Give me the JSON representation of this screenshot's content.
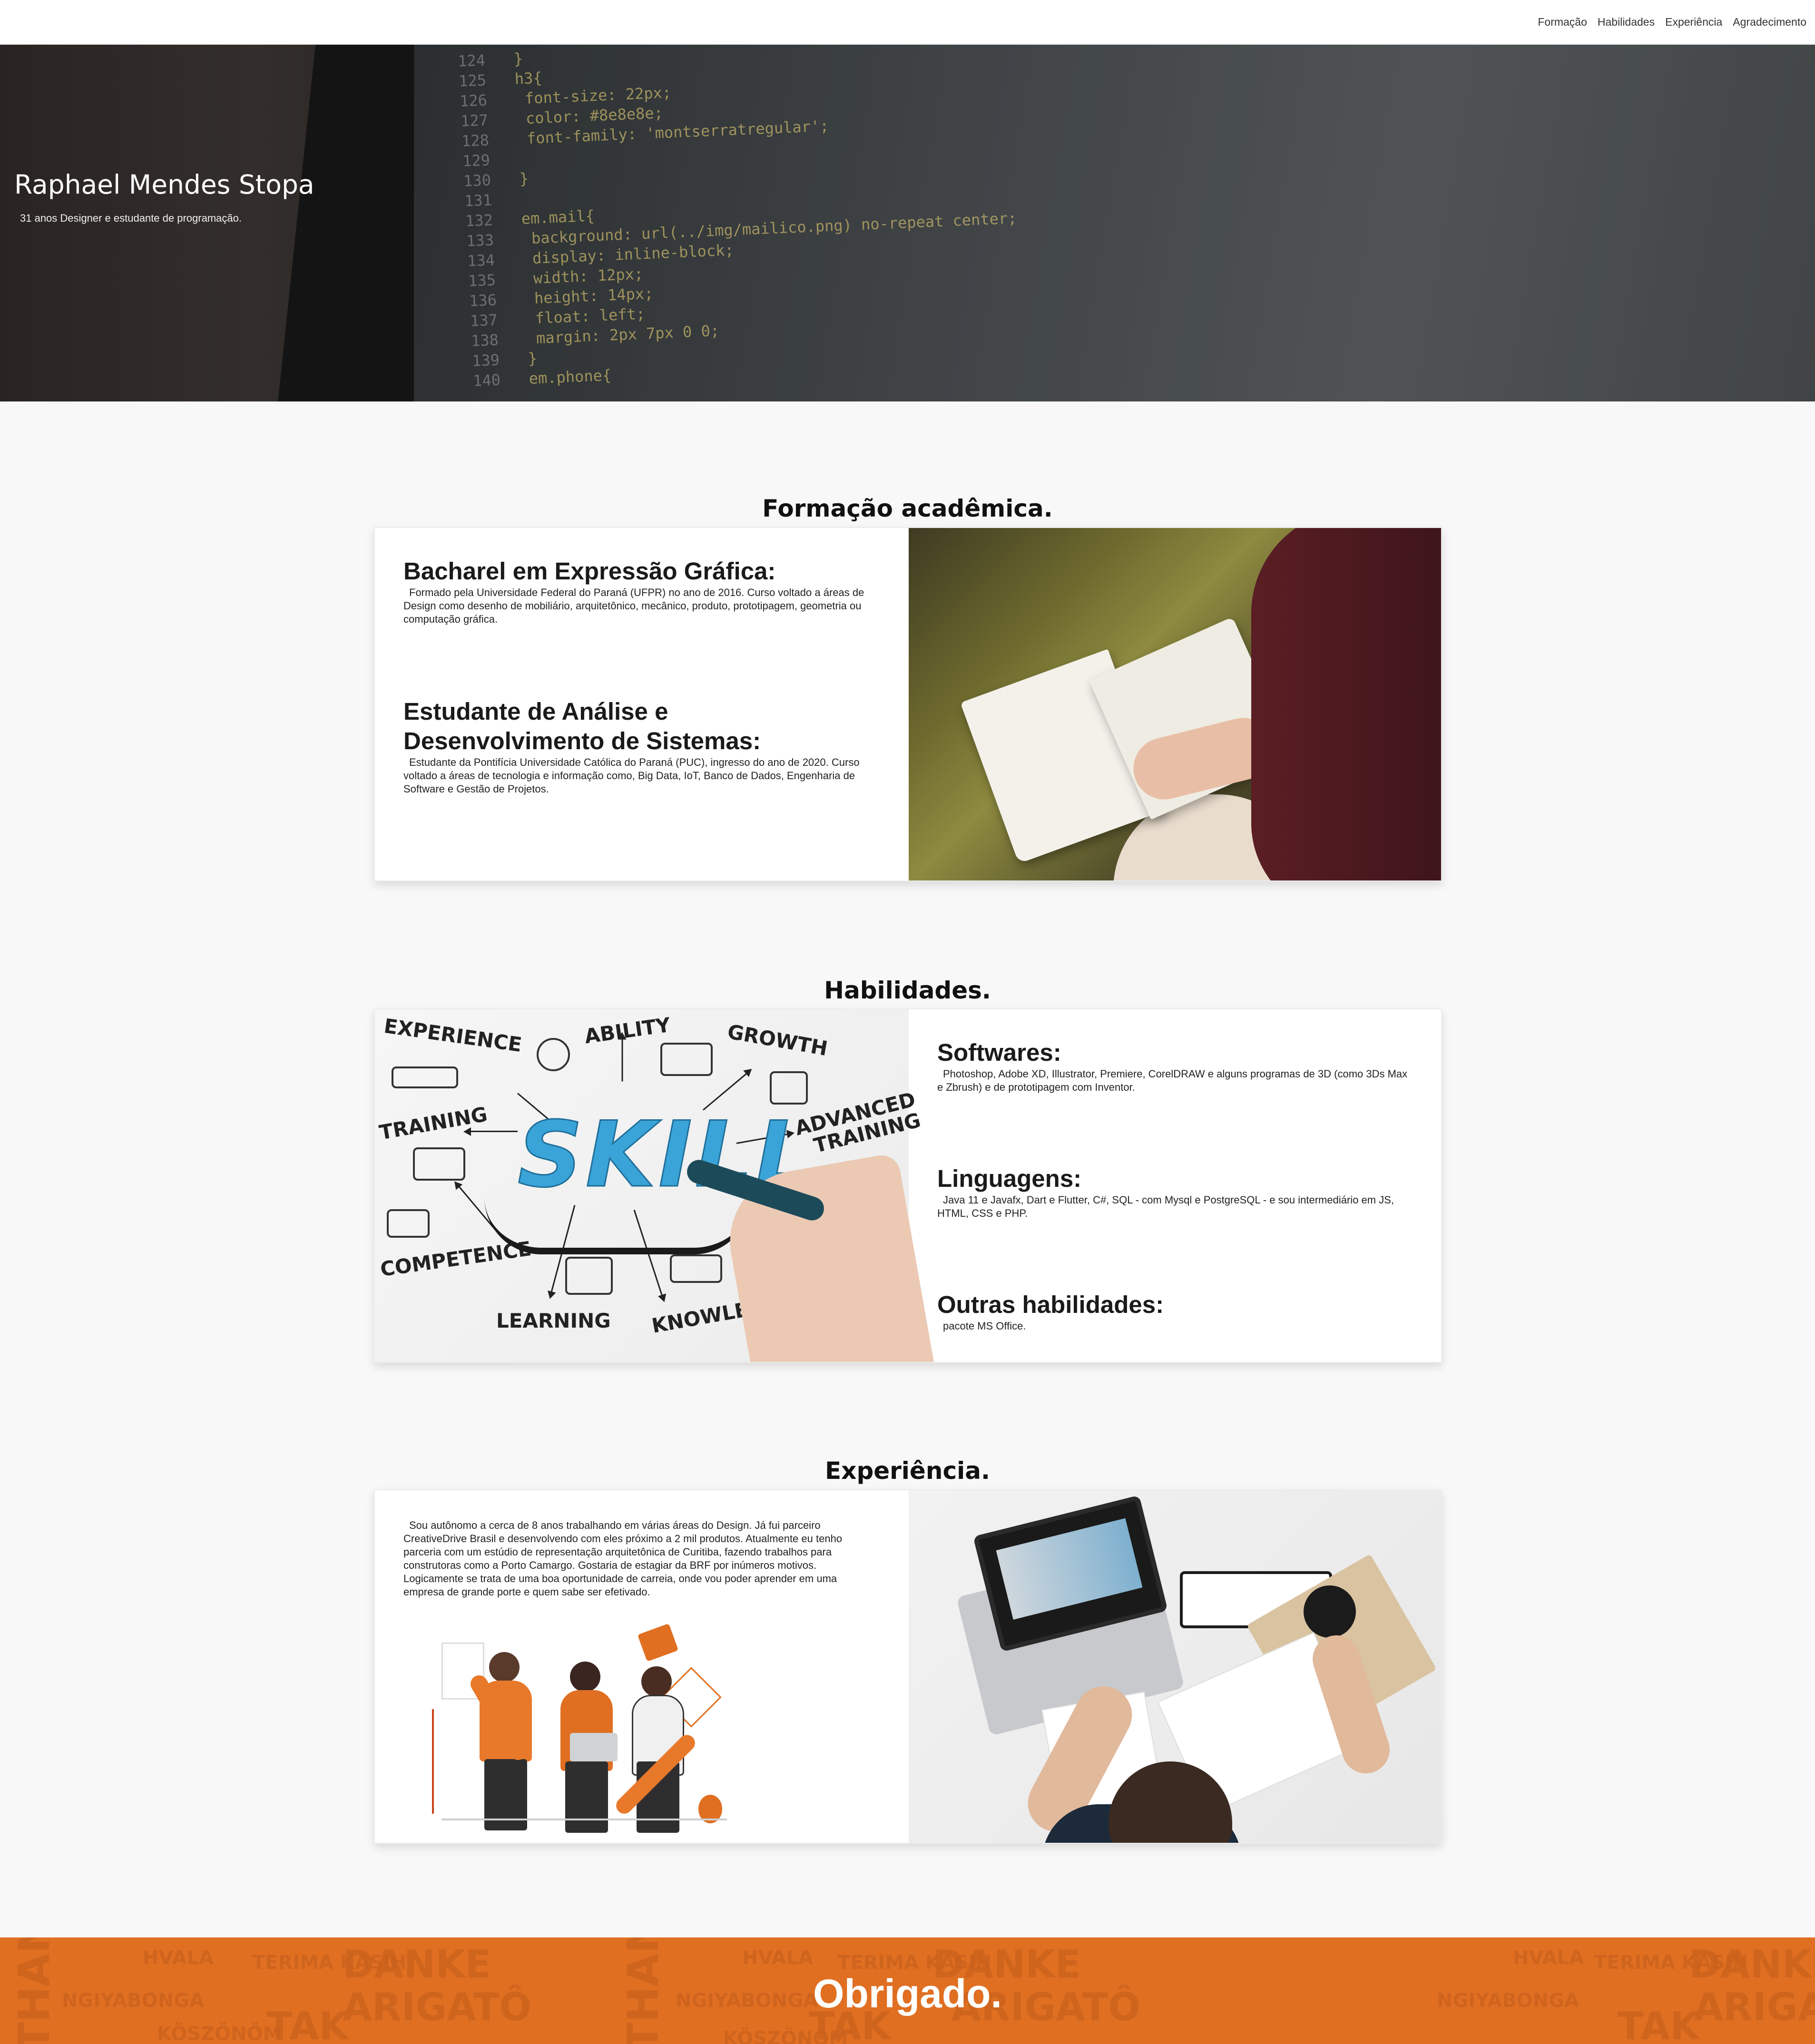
{
  "nav": {
    "items": [
      "Formação",
      "Habilidades",
      "Experiência",
      "Agradecimento"
    ]
  },
  "hero": {
    "name": "Raphael Mendes Stopa",
    "subtitle": "31 anos Designer e estudante de programação.",
    "code_lines": [
      {
        "ln": "124",
        "code": "}"
      },
      {
        "ln": "125",
        "code": "h3{"
      },
      {
        "ln": "126",
        "code": "    font-size: 22px;"
      },
      {
        "ln": "127",
        "code": "    color: #8e8e8e;"
      },
      {
        "ln": "128",
        "code": "    font-family: 'montserratregular';"
      },
      {
        "ln": "129",
        "code": ""
      },
      {
        "ln": "130",
        "code": "}"
      },
      {
        "ln": "131",
        "code": ""
      },
      {
        "ln": "132",
        "code": "em.mail{"
      },
      {
        "ln": "133",
        "code": "    background: url(../img/mailico.png) no-repeat center;"
      },
      {
        "ln": "134",
        "code": "    display: inline-block;"
      },
      {
        "ln": "135",
        "code": "    width: 12px;"
      },
      {
        "ln": "136",
        "code": "    height: 14px;"
      },
      {
        "ln": "137",
        "code": "    float: left;"
      },
      {
        "ln": "138",
        "code": "    margin: 2px 7px 0 0;"
      },
      {
        "ln": "139",
        "code": "}"
      },
      {
        "ln": "140",
        "code": "em.phone{"
      }
    ]
  },
  "formacao": {
    "title": "Formação acadêmica.",
    "items": [
      {
        "heading": "Bacharel em Expressão Gráfica:",
        "text": "Formado pela Universidade Federal do Paraná (UFPR) no ano de 2016. Curso voltado a áreas de Design como desenho de mobiliário, arquitetônico, mecânico, produto, prototipagem, geometria ou computação gráfica."
      },
      {
        "heading_line1": "Estudante de Análise e",
        "heading_line2": "Desenvolvimento de Sistemas:",
        "text": "Estudante da Pontifícia Universidade Católica do Paraná (PUC), ingresso do ano de 2020. Curso voltado a áreas de tecnologia e informação como, Big Data, IoT, Banco de Dados, Engenharia de Software e Gestão de Projetos."
      }
    ]
  },
  "habilidades": {
    "title": "Habilidades.",
    "image_word": "SKILL",
    "image_labels": [
      "EXPERIENCE",
      "ABILITY",
      "GROWTH",
      "TRAINING",
      "ADVANCED",
      "TRAINING",
      "COMPETENCE",
      "LEARNING",
      "KNOWLEDGE"
    ],
    "items": [
      {
        "heading": "Softwares:",
        "text": "Photoshop, Adobe XD, Illustrator, Premiere, CorelDRAW e alguns programas de 3D (como 3Ds Max e Zbrush) e de prototipagem com Inventor."
      },
      {
        "heading": "Linguagens:",
        "text": "Java 11 e Javafx, Dart e Flutter, C#, SQL - com Mysql e PostgreSQL - e sou intermediário em JS, HTML, CSS e PHP."
      },
      {
        "heading": "Outras habilidades:",
        "text": "pacote MS Office."
      }
    ]
  },
  "experiencia": {
    "title": "Experiência.",
    "text": "Sou autônomo a cerca de 8 anos trabalhando em várias áreas do Design. Já fui parceiro CreativeDrive Brasil e desenvolvendo com eles próximo a 2 mil produtos. Atualmente eu tenho parceria com um estúdio de representação arquitetônica de Curitiba, fazendo trabalhos para construtoras como a Porto Camargo. Gostaria de estagiar da BRF por inúmeros motivos. Logicamente se trata de uma boa oportunidade de carreia, onde vou poder aprender em uma empresa de grande porte e quem sabe ser efetivado."
  },
  "footer": {
    "title": "Obrigado.",
    "background_words": [
      "THANK YOU",
      "HVALA",
      "TERIMA KASIH",
      "DANKE",
      "ARIGATÔ",
      "NGIYABONGA",
      "TAK",
      "KÖSZÖNÖM",
      "THANK YOU",
      "HVALA",
      "TERIMA KASIH",
      "DANKE",
      "ARIGATÔ",
      "NGIYABONGA",
      "TAK",
      "KÖSZÖNÖM",
      "HVALA",
      "TERIMA KASIH",
      "DANKE",
      "ARIGATÔ",
      "NGIYABONGA",
      "TAK"
    ]
  },
  "colors": {
    "accent_orange": "#e06f22",
    "page_bg": "#f8f8f8",
    "skill_blue": "#3aa3d8"
  }
}
